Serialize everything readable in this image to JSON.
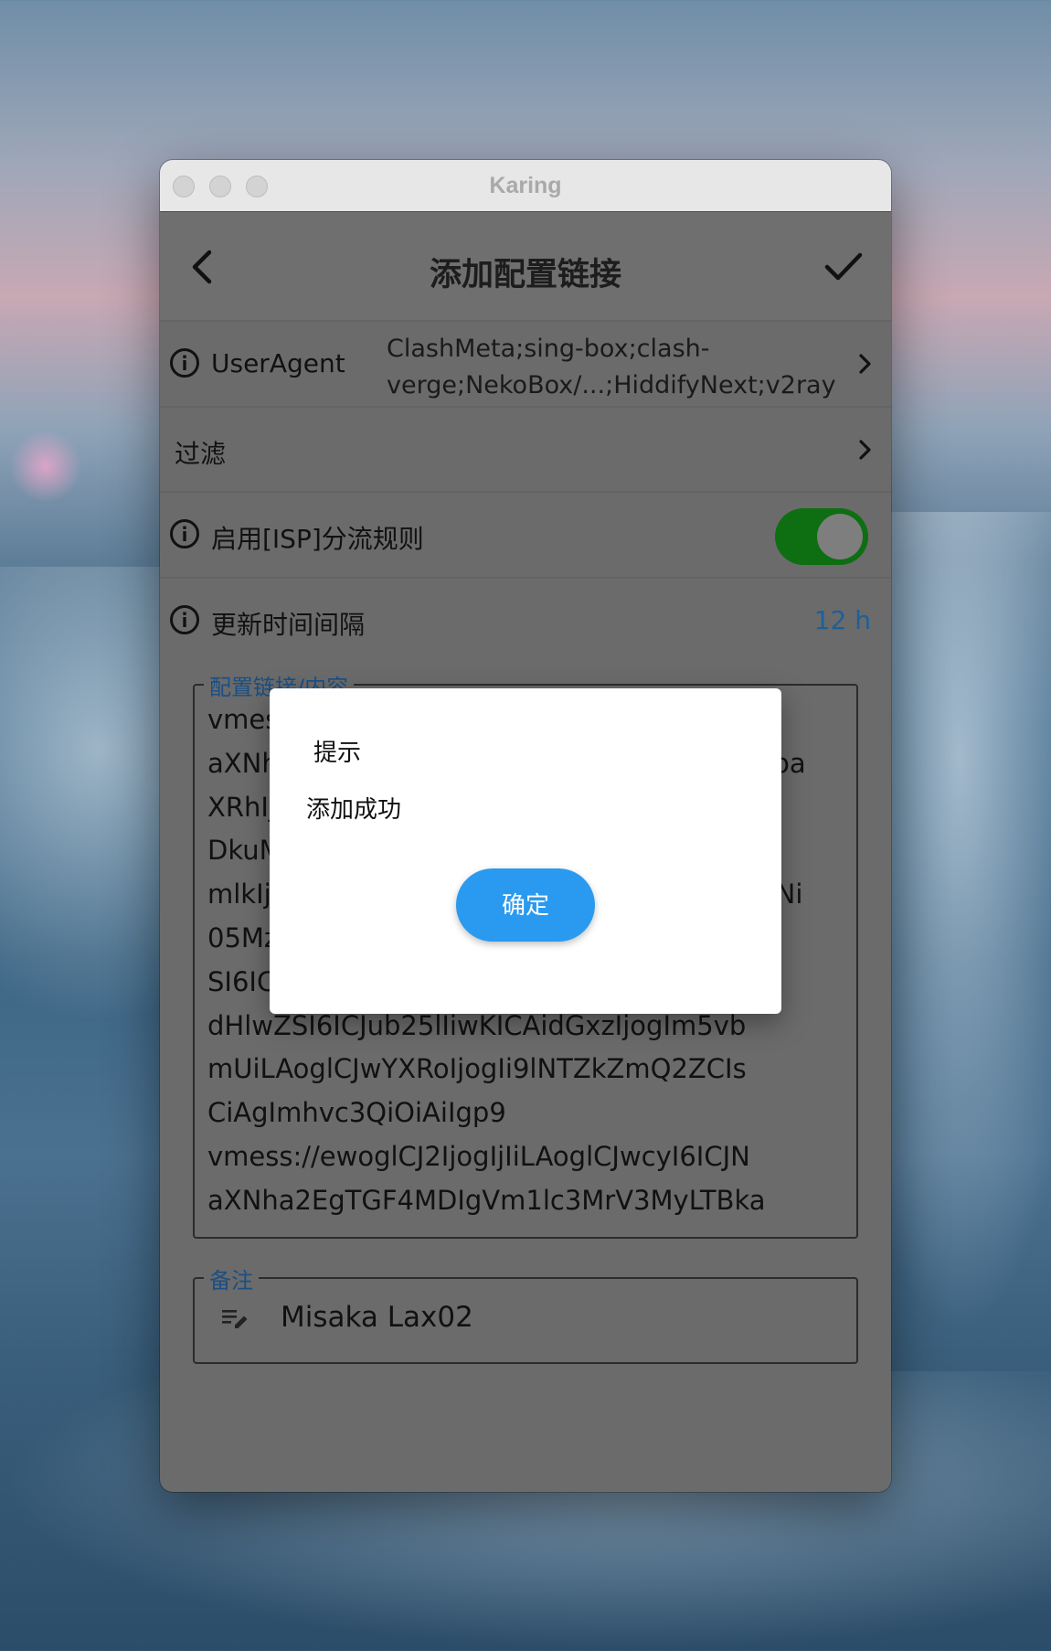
{
  "window": {
    "title": "Karing"
  },
  "appbar": {
    "title": "添加配置链接",
    "back_icon": "back-arrow-icon",
    "confirm_icon": "checkmark-icon"
  },
  "settings": {
    "user_agent": {
      "label": "UserAgent",
      "value_line1": "ClashMeta;sing-box;clash-",
      "value_line2": "verge;NekoBox/...;HiddifyNext;v2ray"
    },
    "filter": {
      "label": "过滤"
    },
    "isp_rules": {
      "label": "启用[ISP]分流规则",
      "enabled": true
    },
    "update_interval": {
      "label": "更新时间间隔",
      "value": "12 h"
    }
  },
  "content_field": {
    "legend": "配置链接/内容",
    "lines": [
      "vmess://ewoglCJ2IjogIjIiLAoglCJwcyI6ICJN",
      "aXNha2EgTGF4MDIgVm1lc3MrV3MyLTBkaJoa",
      "XRhIjogIjEiLAoglCJhZGQiOiAiMTcyLjY3LjxM",
      "DkuMjIiLAoglCJwb3J0IjogIjQ0MyIsCiAglAgI",
      "mlkIjogImM3YWE2ZmY5LTk3MzctNGE2Zi1lNi",
      "05MzYzLWE3ZjU0NzUzODkwNyIsCiAglmNje",
      "SI6ICJhdXRvIiwKICAibmV0IjogIndzIiwKICAi",
      "dHlwZSI6ICJub25lIiwKICAidGxzIjogIm5vb",
      "mUiLAoglCJwYXRoIjogIi9lNTZkZmQ2ZCIs",
      "CiAgImhvc3QiOiAiIgp9",
      "vmess://ewoglCJ2IjogIjIiLAoglCJwcyI6ICJN",
      "aXNha2EgTGF4MDIgVm1lc3MrV3MyLTBka"
    ]
  },
  "note_field": {
    "legend": "备注",
    "value": "Misaka Lax02",
    "icon": "edit-note-icon"
  },
  "dialog": {
    "title": "提示",
    "message": "添加成功",
    "confirm_label": "确定"
  }
}
